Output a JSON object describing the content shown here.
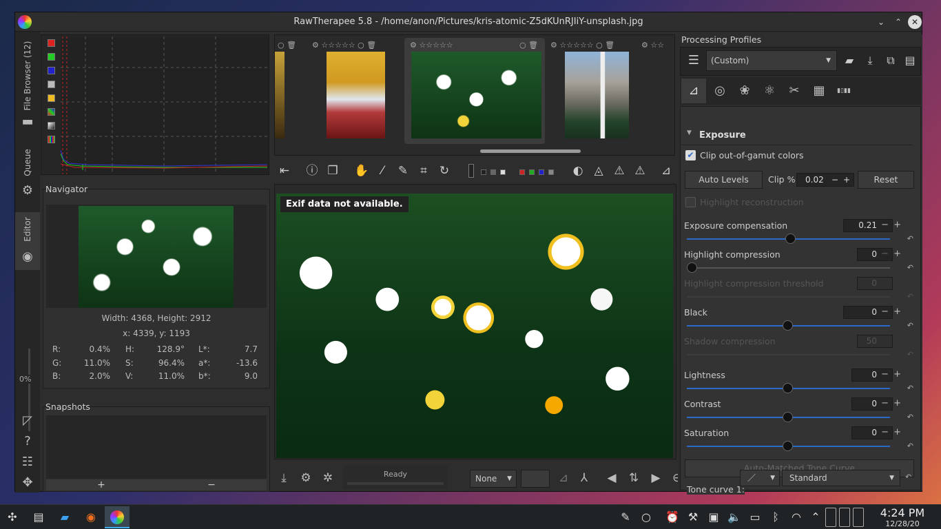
{
  "window": {
    "title": "RawTherapee 5.8 - /home/anon/Pictures/kris-atomic-Z5dKUnRJIiY-unsplash.jpg"
  },
  "vtabs": {
    "file_browser": "File Browser (12)",
    "queue": "Queue",
    "editor": "Editor"
  },
  "histogram": {
    "channels": [
      "red",
      "green",
      "blue",
      "luminance",
      "chroma",
      "raw",
      "bar",
      "rgb"
    ]
  },
  "navigator": {
    "title": "Navigator",
    "size": "Width: 4368, Height: 2912",
    "coords": "x: 4339, y: 1193",
    "values": {
      "r_label": "R:",
      "r_val": "0.4%",
      "h_label": "H:",
      "h_val": "128.9°",
      "l_label": "L*:",
      "l_val": "7.7",
      "g_label": "G:",
      "g_val": "11.0%",
      "s_label": "S:",
      "s_val": "96.4%",
      "a_label": "a*:",
      "a_val": "-13.6",
      "b_label": "B:",
      "b_val": "2.0%",
      "v_label": "V:",
      "v_val": "11.0%",
      "bb_label": "b*:",
      "bb_val": "9.0"
    }
  },
  "snapshots": {
    "title": "Snapshots",
    "add": "+",
    "remove": "−"
  },
  "progress": {
    "percent": "0%"
  },
  "main": {
    "exif": "Exif data not available."
  },
  "bottom": {
    "status": "Ready",
    "none_select": "None"
  },
  "profiles": {
    "title": "Processing Profiles",
    "value": "(Custom)"
  },
  "exposure": {
    "title": "Exposure",
    "clip_gamut": "Clip out-of-gamut colors",
    "auto_levels": "Auto Levels",
    "clip_label": "Clip %",
    "clip_val": "0.02",
    "reset": "Reset",
    "highlight_recon": "Highlight reconstruction",
    "exp_comp": "Exposure compensation",
    "exp_comp_val": "0.21",
    "hl_comp": "Highlight compression",
    "hl_comp_val": "0",
    "hl_thresh": "Highlight compression threshold",
    "hl_thresh_val": "0",
    "black": "Black",
    "black_val": "0",
    "shadow": "Shadow compression",
    "shadow_val": "50",
    "lightness": "Lightness",
    "lightness_val": "0",
    "contrast": "Contrast",
    "contrast_val": "0",
    "saturation": "Saturation",
    "saturation_val": "0",
    "auto_tone": "Auto-Matched Tone Curve",
    "tone_curve": "Tone curve 1:",
    "tone_type": "Standard"
  },
  "taskbar": {
    "time": "4:24 PM",
    "date": "12/28/20"
  },
  "colors": {
    "accent": "#2a69c8",
    "bg": "#2d2d2d"
  }
}
